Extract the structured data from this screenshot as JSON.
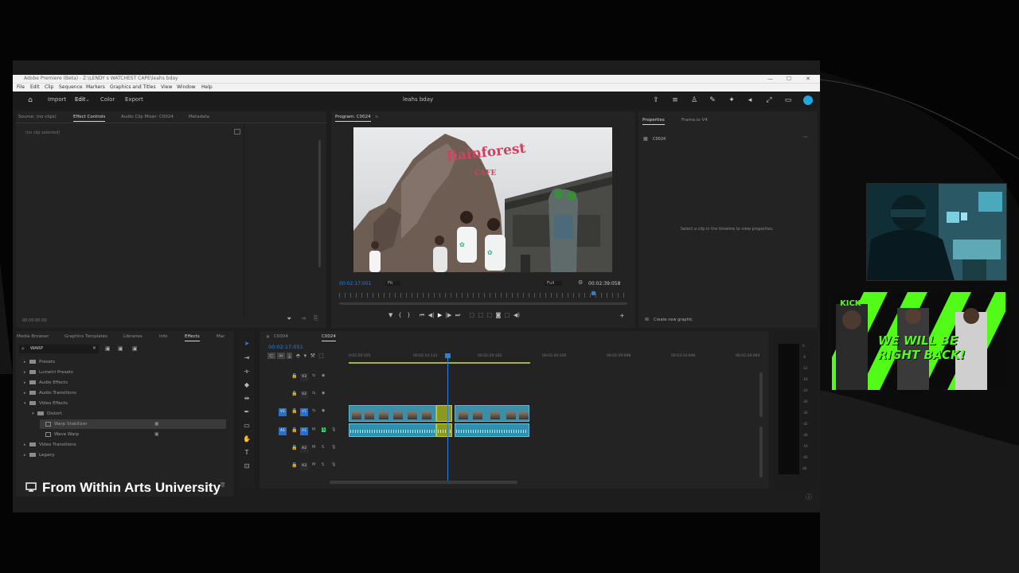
{
  "window": {
    "title": "Adobe Premiere (Beta) - Z:\\LENDY s WATCHEST CAPE\\leahs bday",
    "controls": [
      "—",
      "☐",
      "✕"
    ]
  },
  "menu": [
    "File",
    "Edit",
    "Clip",
    "Sequence",
    "Markers",
    "Graphics and Titles",
    "View",
    "Window",
    "Help"
  ],
  "workspace": {
    "tabs": [
      "Import",
      "Edit",
      "Color",
      "Export"
    ],
    "active_tab": "Edit",
    "project_title": "leahs bday"
  },
  "source_panel": {
    "tabs": [
      "Source: (no clips)",
      "Effect Controls",
      "Audio Clip Mixer: C0024",
      "Metadata"
    ],
    "active": "Effect Controls",
    "empty_text": "(no clip selected)",
    "timecode": "00:00:00:00"
  },
  "program": {
    "title": "Program: C0024",
    "current_time": "00:02:17:051",
    "fit": "Fit",
    "quality": "Full",
    "duration": "00:02:39:058",
    "playhead_fraction": 0.88
  },
  "properties": {
    "tabs": [
      "Properties",
      "Frame.io V4"
    ],
    "clip_name": "C0024",
    "hint": "Select a clip in the timeline to view properties.",
    "create_graphic": "Create new graphic"
  },
  "effects_panel": {
    "tabs": [
      "Media Browser",
      "Graphics Templates",
      "Libraries",
      "Info",
      "Effects",
      "Mar"
    ],
    "active": "Effects",
    "search_value": "WARP",
    "tree": [
      {
        "label": "Presets",
        "depth": 0,
        "open": false
      },
      {
        "label": "Lumetri Presets",
        "depth": 0,
        "open": false
      },
      {
        "label": "Audio Effects",
        "depth": 0,
        "open": false
      },
      {
        "label": "Audio Transitions",
        "depth": 0,
        "open": false
      },
      {
        "label": "Video Effects",
        "depth": 0,
        "open": true
      },
      {
        "label": "Distort",
        "depth": 1,
        "open": true
      },
      {
        "label": "Warp Stabilizer",
        "depth": 2,
        "selected": true
      },
      {
        "label": "Wave Warp",
        "depth": 2
      },
      {
        "label": "Video Transitions",
        "depth": 0,
        "open": false
      },
      {
        "label": "Legacy",
        "depth": 0,
        "open": false
      }
    ]
  },
  "timeline": {
    "tabs": [
      "C0004",
      "C0024"
    ],
    "active": "C0024",
    "timecode": "00:02:17:051",
    "ruler": [
      "0:02:59:105",
      "00:02:14:133",
      "00:02:29:102",
      "00:02:44:100",
      "00:02:59:098",
      "00:03:14:096",
      "00:03:29:094"
    ],
    "tracks": {
      "video": [
        "V3",
        "V2",
        "V1"
      ],
      "audio": [
        "A1",
        "A2",
        "A3"
      ]
    },
    "meter_labels": [
      "0",
      "-6",
      "-12",
      "-18",
      "-24",
      "-30",
      "-36",
      "-42",
      "-48",
      "-54",
      "-60",
      "dB"
    ]
  },
  "overlay": {
    "caption": "From Within Arts University",
    "brb_brand": "KICK",
    "brb_text": "WE WILL BE RIGHT BACK!"
  },
  "colors": {
    "accent_blue": "#2d7fd9",
    "clip_video": "#3a8fa8",
    "clip_audio": "#2f8fb0",
    "kick_green": "#53fc18"
  }
}
